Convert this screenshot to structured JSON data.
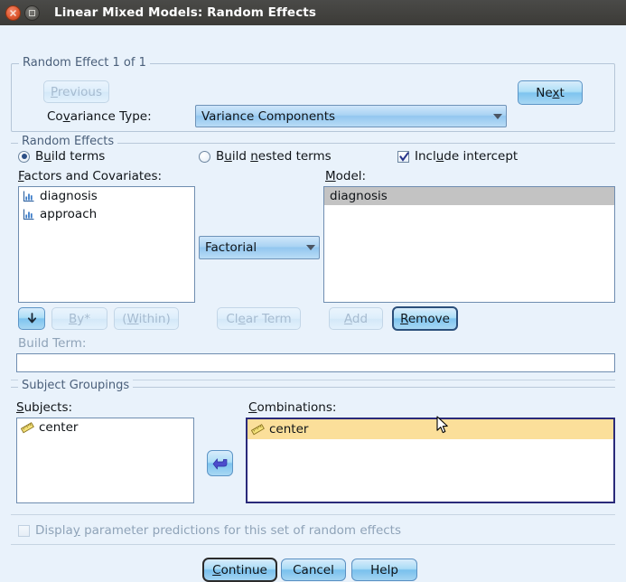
{
  "window": {
    "title": "Linear Mixed Models: Random Effects",
    "close_icon": "close-icon",
    "maximize_icon": "maximize-icon"
  },
  "random_effect_group": {
    "legend": "Random Effect 1 of 1",
    "previous_button": "Previous",
    "next_button": "Next",
    "covariance_type_label": "Covariance Type:",
    "covariance_type_value": "Variance Components"
  },
  "random_effects_group": {
    "legend": "Random Effects",
    "build_terms_radio": "Build terms",
    "build_nested_terms_radio": "Build nested terms",
    "include_intercept_checkbox": "Include intercept",
    "factors_label": "Factors and Covariates:",
    "model_label": "Model:",
    "factors_items": [
      {
        "label": "diagnosis",
        "icon": "nominal-variable-icon"
      },
      {
        "label": "approach",
        "icon": "nominal-variable-icon"
      }
    ],
    "model_items": [
      {
        "label": "diagnosis",
        "selected": true
      }
    ],
    "term_type_value": "Factorial",
    "down_arrow_button": "↓",
    "by_button": "By*",
    "within_button": "(Within)",
    "clear_term_button": "Clear Term",
    "add_button": "Add",
    "remove_button": "Remove",
    "build_term_label": "Build Term:",
    "build_term_value": ""
  },
  "subject_groupings_group": {
    "legend": "Subject Groupings",
    "subjects_label": "Subjects:",
    "combinations_label": "Combinations:",
    "subjects_items": [
      {
        "label": "center",
        "icon": "scale-variable-icon"
      }
    ],
    "combinations_items": [
      {
        "label": "center",
        "icon": "scale-variable-icon",
        "selected": true
      }
    ],
    "move_button_icon": "arrow-left-icon"
  },
  "footer": {
    "display_predictions_checkbox": "Display parameter predictions for this set of random effects",
    "continue_button": "Continue",
    "cancel_button": "Cancel",
    "help_button": "Help"
  },
  "colors": {
    "dialog_background": "#e9f2fb",
    "titlebar": "#3f3e3a",
    "selection_gray": "#c3c3c3",
    "selection_amber": "#fbdf9a",
    "accent_blue": "#7ec4ef",
    "close_button": "#e05a32"
  }
}
